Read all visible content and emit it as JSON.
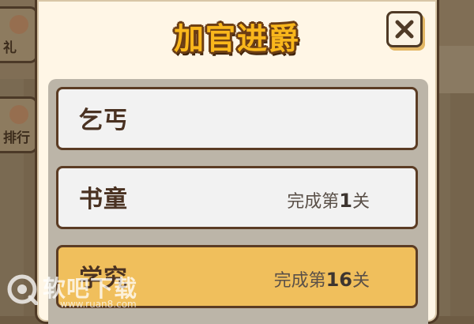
{
  "background": {
    "left_buttons": [
      {
        "label": "礼"
      },
      {
        "label": "排行"
      }
    ]
  },
  "dialog": {
    "title": "加官进爵",
    "close_icon": "close-icon",
    "ranks": [
      {
        "name": "乞丐",
        "condition": "",
        "highlighted": false
      },
      {
        "name": "书童",
        "condition_prefix": "完成第",
        "level": "1",
        "condition_suffix": "关",
        "highlighted": false
      },
      {
        "name": "学究",
        "condition_prefix": "完成第",
        "level": "16",
        "condition_suffix": "关",
        "highlighted": true
      }
    ]
  },
  "watermark": {
    "text": "软吧下载",
    "url": "www.ruan8.com"
  },
  "colors": {
    "title": "#f9b71c",
    "highlight": "#f0bf5c",
    "item_border": "#5b3c24"
  }
}
